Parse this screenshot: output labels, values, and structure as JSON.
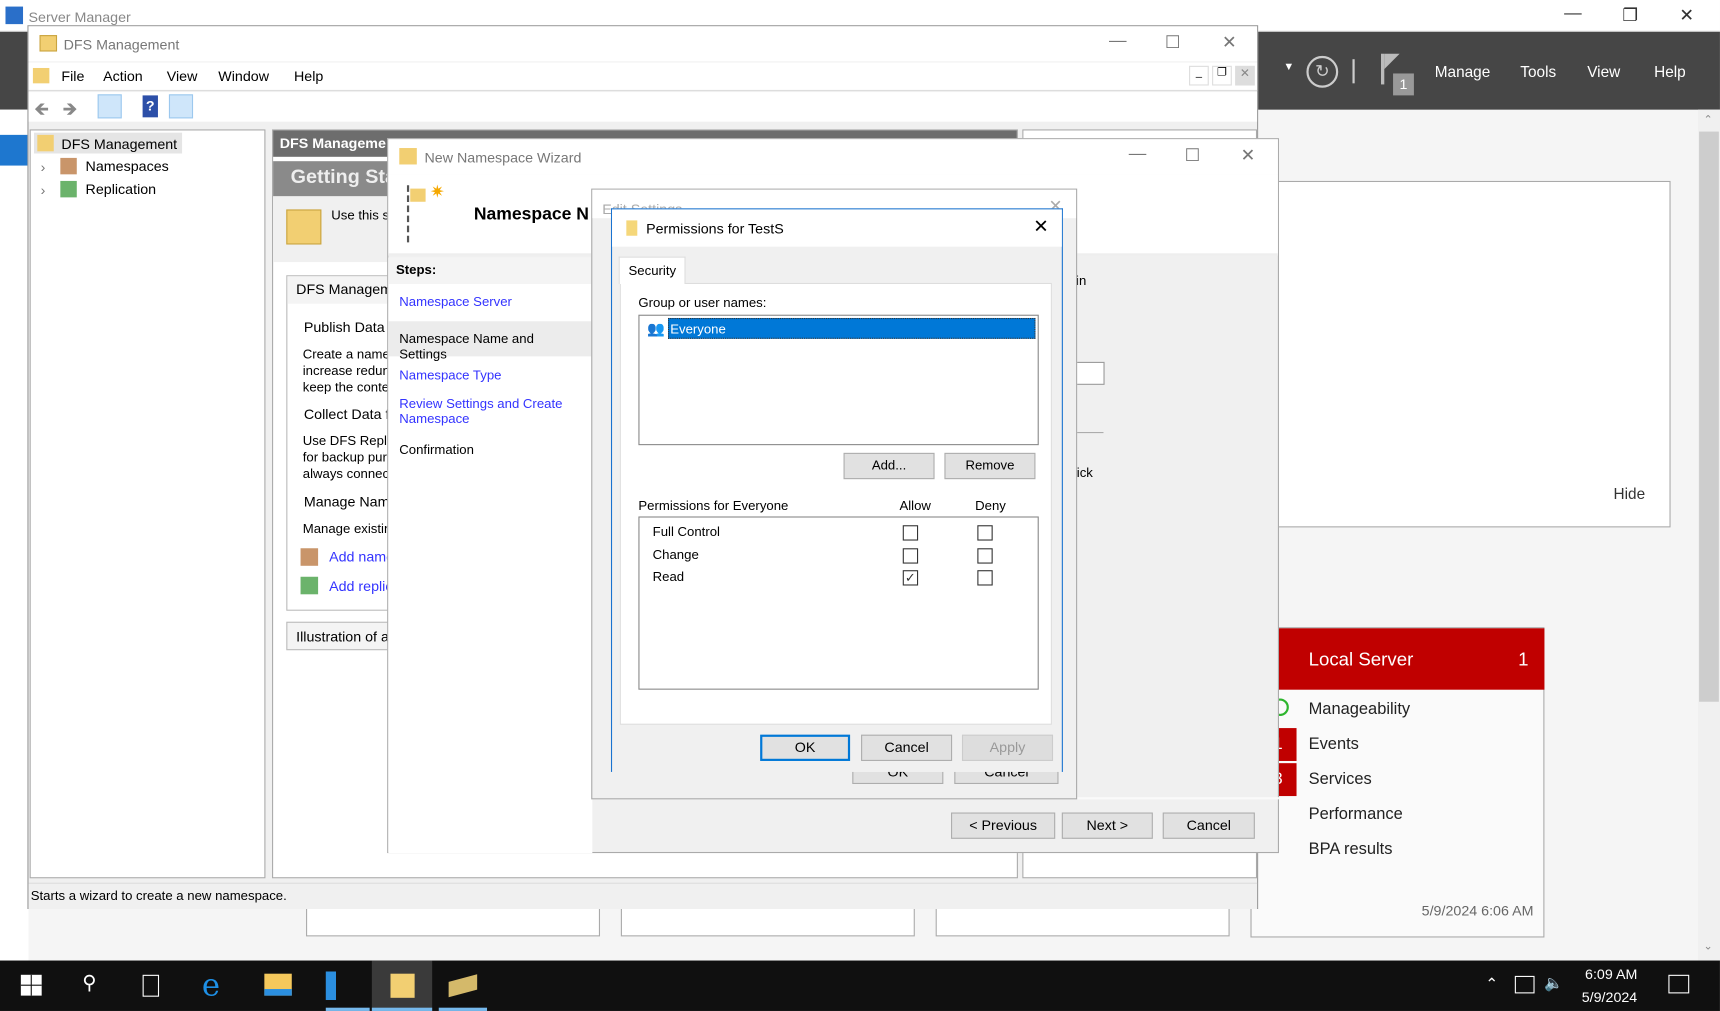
{
  "server_manager": {
    "title": "Server Manager",
    "header_menu": [
      "Manage",
      "Tools",
      "View",
      "Help"
    ],
    "flag_badge": "1",
    "hide_label": "Hide",
    "local_server": {
      "title": "Local Server",
      "count": "1",
      "rows": [
        {
          "label": "Manageability",
          "badge": ""
        },
        {
          "label": "Events",
          "badge": "1"
        },
        {
          "label": "Services",
          "badge": "3"
        },
        {
          "label": "Performance",
          "badge": ""
        },
        {
          "label": "BPA results",
          "badge": ""
        }
      ],
      "timestamp": "5/9/2024 6:06 AM"
    },
    "colors": {
      "header": "#464646",
      "alert": "#c00000"
    }
  },
  "dfs": {
    "title": "DFS Management",
    "menu": [
      "File",
      "Action",
      "View",
      "Window",
      "Help"
    ],
    "tree": [
      "DFS Management",
      "Namespaces",
      "Replication"
    ],
    "main_header": "DFS Manageme",
    "banner": "Getting Sta",
    "intro": "Use this s",
    "section_title": "DFS Managem",
    "items": [
      "Publish Data",
      "Create a name",
      "increase redun",
      "keep the conte",
      "Collect Data f",
      "Use DFS Repli",
      "for backup pur",
      "always connec",
      "Manage Nam",
      "Manage existin"
    ],
    "links": [
      "Add name",
      "Add replic"
    ],
    "illustration": "Illustration of a",
    "status": "Starts a wizard to create a new namespace."
  },
  "wizard": {
    "title": "New Namespace Wizard",
    "heading": "Namespace N",
    "steps_label": "Steps:",
    "steps": [
      "Namespace Server",
      "Namespace Name and Settings",
      "Namespace Type",
      "Review Settings and Create Namespace",
      "Confirmation"
    ],
    "fragments": [
      "in",
      "lick"
    ],
    "buttons": {
      "previous": "< Previous",
      "next": "Next >",
      "cancel": "Cancel"
    }
  },
  "edit_settings": {
    "title": "Edit Settings",
    "buttons": {
      "ok": "OK",
      "cancel": "Cancel"
    }
  },
  "permissions": {
    "title": "Permissions for TestS",
    "tab": "Security",
    "group_label": "Group or user names:",
    "users": [
      "Everyone"
    ],
    "add": "Add...",
    "remove": "Remove",
    "perm_label": "Permissions for Everyone",
    "allow": "Allow",
    "deny": "Deny",
    "rows": [
      {
        "name": "Full Control",
        "allow": false,
        "deny": false
      },
      {
        "name": "Change",
        "allow": false,
        "deny": false
      },
      {
        "name": "Read",
        "allow": true,
        "deny": false
      }
    ],
    "ok": "OK",
    "cancel": "Cancel",
    "apply": "Apply"
  },
  "taskbar": {
    "time": "6:09 AM",
    "date": "5/9/2024"
  }
}
